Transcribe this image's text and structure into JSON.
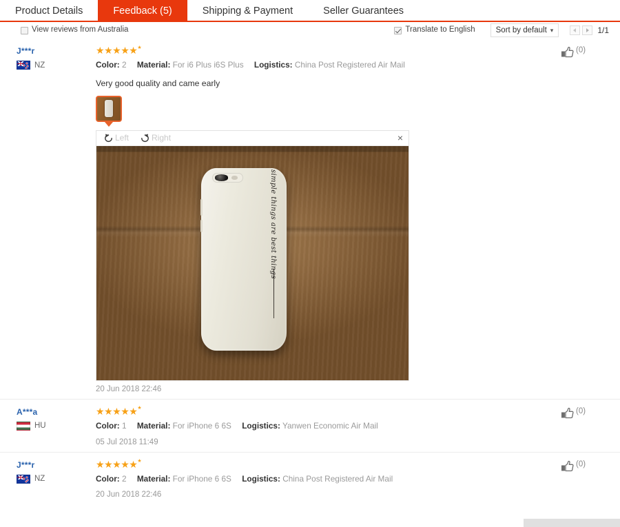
{
  "tabs": [
    {
      "label": "Product Details",
      "active": false
    },
    {
      "label": "Feedback (5)",
      "active": true
    },
    {
      "label": "Shipping & Payment",
      "active": false
    },
    {
      "label": "Seller Guarantees",
      "active": false
    }
  ],
  "toolbar": {
    "view_local_label": "View reviews from Australia",
    "view_local_checked": false,
    "translate_label": "Translate to English",
    "translate_checked": true,
    "sort_label": "Sort by default",
    "page_indicator": "1/1"
  },
  "labels": {
    "color": "Color:",
    "material": "Material:",
    "logistics": "Logistics:",
    "rotate_left": "Left",
    "rotate_right": "Right",
    "close": "×"
  },
  "colors": {
    "accent": "#e8380d",
    "star": "#f7a117",
    "link": "#2b63ad",
    "thumb_border": "#e8622b"
  },
  "reviews": [
    {
      "name": "J***r",
      "country_code": "NZ",
      "flag": "flag-nz",
      "stars": 5,
      "color": "2",
      "material": "For i6 Plus i6S Plus",
      "logistics": "China Post Registered Air Mail",
      "text": "Very good quality and came early",
      "date": "20 Jun 2018 22:46",
      "helpful_count": "(0)",
      "has_photo": true,
      "photo_caption": "simple things are best things"
    },
    {
      "name": "A***a",
      "country_code": "HU",
      "flag": "flag-hu",
      "stars": 5,
      "color": "1",
      "material": "For iPhone 6 6S",
      "logistics": "Yanwen Economic Air Mail",
      "text": "",
      "date": "05 Jul 2018 11:49",
      "helpful_count": "(0)",
      "has_photo": false,
      "photo_caption": ""
    },
    {
      "name": "J***r",
      "country_code": "NZ",
      "flag": "flag-nz",
      "stars": 5,
      "color": "2",
      "material": "For iPhone 6 6S",
      "logistics": "China Post Registered Air Mail",
      "text": "",
      "date": "20 Jun 2018 22:46",
      "helpful_count": "(0)",
      "has_photo": false,
      "photo_caption": ""
    }
  ]
}
